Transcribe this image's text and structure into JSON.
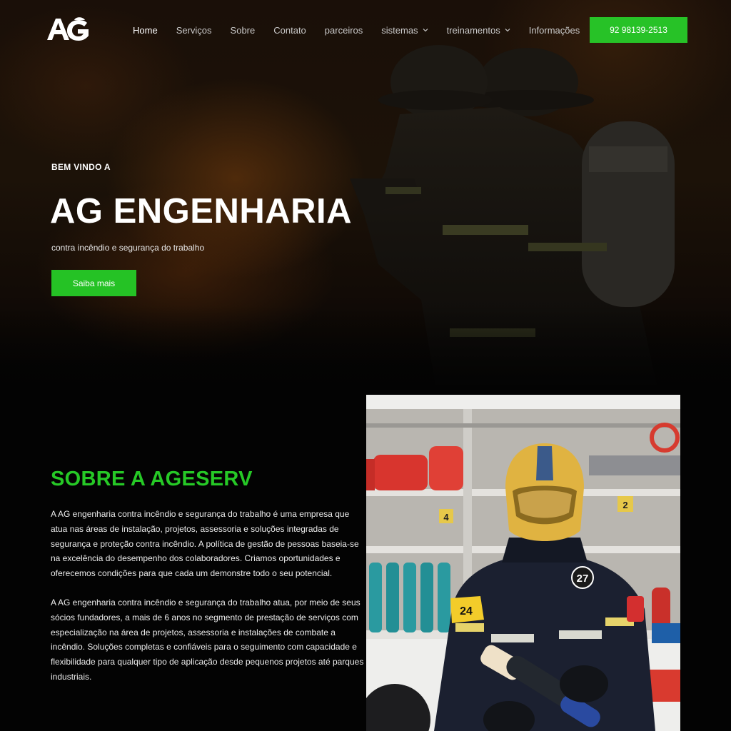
{
  "brand": {
    "logo_text": "AG",
    "accent_color": "#27c227"
  },
  "nav": {
    "items": [
      {
        "label": "Home",
        "active": true,
        "dropdown": false
      },
      {
        "label": "Serviços",
        "active": false,
        "dropdown": false
      },
      {
        "label": "Sobre",
        "active": false,
        "dropdown": false
      },
      {
        "label": "Contato",
        "active": false,
        "dropdown": false
      },
      {
        "label": "parceiros",
        "active": false,
        "dropdown": false
      },
      {
        "label": "sistemas",
        "active": false,
        "dropdown": true
      },
      {
        "label": "treinamentos",
        "active": false,
        "dropdown": true
      },
      {
        "label": "Informações",
        "active": false,
        "dropdown": false
      }
    ],
    "phone_button": "92 98139-2513"
  },
  "hero": {
    "kicker": "BEM VINDO A",
    "title": "AG ENGENHARIA",
    "subtitle": "contra incêndio e segurança do trabalho",
    "cta": "Saiba mais"
  },
  "about": {
    "title": "SOBRE A AGESERV",
    "paragraph_1": "A AG engenharia contra incêndio e segurança do trabalho é uma empresa que atua nas áreas de instalação, projetos, assessoria e soluções integradas de segurança e proteção contra incêndio. A política de gestão de pessoas baseia-se na excelência do desempenho dos colaboradores. Criamos oportunidades e oferecemos condições para que cada um demonstre todo o seu potencial.",
    "paragraph_2": "A AG engenharia contra incêndio e segurança do trabalho  atua, por meio de seus sócios fundadores, a mais de 6 anos no segmento de prestação de serviços com especialização na área de projetos, assessoria e instalações de combate a incêndio. Soluções completas e confiáveis para o seguimento com capacidade e flexibilidade para qualquer tipo de aplicação desde pequenos projetos até parques industriais.",
    "photo_labels": {
      "helmet_number": "27",
      "sleeve_badge": "24",
      "shelf_number_1": "4",
      "shelf_number_2": "2"
    }
  }
}
